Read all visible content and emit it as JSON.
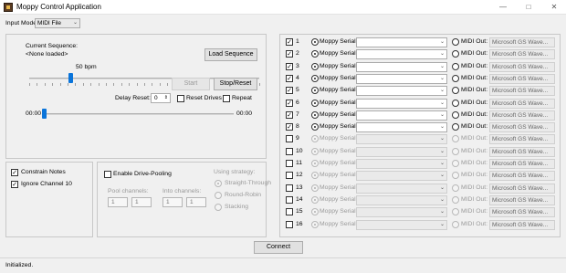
{
  "window": {
    "title": "Moppy Control Application",
    "minimize": "—",
    "maximize": "□",
    "close": "✕"
  },
  "input_mode": {
    "label": "Input Mode",
    "value": "MIDI File"
  },
  "sequence": {
    "current_label": "Current Sequence:",
    "current_value": "<None loaded>",
    "load_button": "Load Sequence",
    "tempo": "50 bpm",
    "tempo_fraction": 0.18,
    "start_button": "Start",
    "stop_button": "Stop/Reset",
    "delay_label": "Delay Reset:",
    "delay_value": "0",
    "reset_drives": "Reset Drives",
    "repeat": "Repeat",
    "time_start": "00:00",
    "time_end": "00:00",
    "position_fraction": 0.0
  },
  "options": {
    "constrain_notes": "Constrain Notes",
    "constrain_checked": true,
    "ignore_channel": "Ignore Channel 10",
    "ignore_checked": true
  },
  "pooling": {
    "enable_label": "Enable Drive-Pooling",
    "pool_channels_label": "Pool channels:",
    "into_channels_label": "Into channels:",
    "pool_from": "1",
    "pool_to": "1",
    "into_from": "1",
    "into_to": "1",
    "strategy_label": "Using strategy:",
    "strategies": [
      "Straight-Through",
      "Round-Robin",
      "Stacking"
    ],
    "selected_strategy": "Straight-Through"
  },
  "channels_labels": {
    "serial": "Moppy Serial:",
    "midi": "MIDI Out:",
    "device": "Microsoft GS Wave..."
  },
  "channels": [
    {
      "num": "1",
      "enabled": true
    },
    {
      "num": "2",
      "enabled": true
    },
    {
      "num": "3",
      "enabled": true
    },
    {
      "num": "4",
      "enabled": true
    },
    {
      "num": "5",
      "enabled": true
    },
    {
      "num": "6",
      "enabled": true
    },
    {
      "num": "7",
      "enabled": true
    },
    {
      "num": "8",
      "enabled": true
    },
    {
      "num": "9",
      "enabled": false
    },
    {
      "num": "10",
      "enabled": false
    },
    {
      "num": "11",
      "enabled": false
    },
    {
      "num": "12",
      "enabled": false
    },
    {
      "num": "13",
      "enabled": false
    },
    {
      "num": "14",
      "enabled": false
    },
    {
      "num": "15",
      "enabled": false
    },
    {
      "num": "16",
      "enabled": false
    }
  ],
  "connect_button": "Connect",
  "status": "Initialized."
}
